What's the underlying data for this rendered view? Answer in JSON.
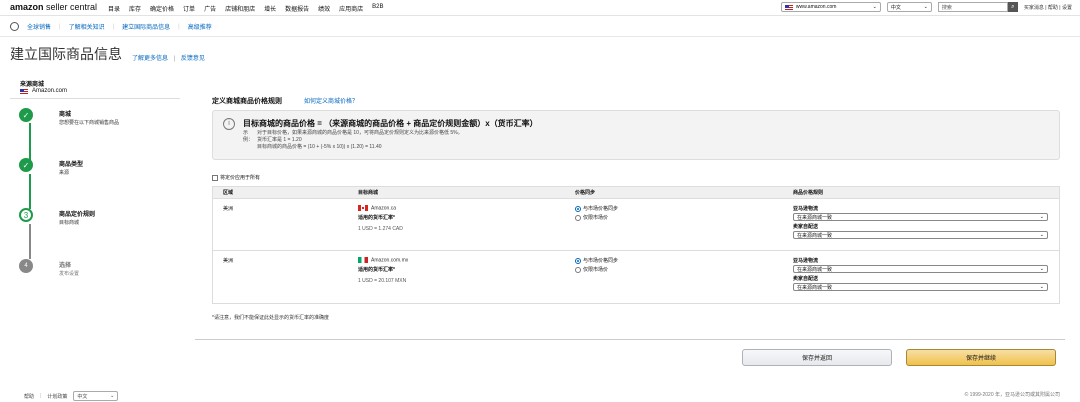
{
  "topnav": {
    "logo_brand": "amazon",
    "logo_product": "seller central",
    "menu": [
      "目录",
      "库存",
      "确定价格",
      "订单",
      "广告",
      "店铺和朋店",
      "增长",
      "数据报告",
      "绩效",
      "应用商店",
      "B2B"
    ],
    "marketplace": "www.amazon.com",
    "language": "中文",
    "search_placeholder": "搜索",
    "links": "买家消息 | 帮助 | 设置"
  },
  "subnav": {
    "items": [
      "全球销售",
      "了解相关知识",
      "建立国际商品信息",
      "高级推荐"
    ]
  },
  "page": {
    "title": "建立国际商品信息",
    "link1": "了解更多信息",
    "link2": "反馈意见"
  },
  "sidebar": {
    "source_label": "来源商城",
    "source_market": "Amazon.com",
    "steps": [
      {
        "label": "商城",
        "desc": "您想要在以下商城销售商品",
        "state": "done"
      },
      {
        "label": "商品类型",
        "desc": "来源",
        "state": "done"
      },
      {
        "label": "商品定价规则",
        "desc": "目标商城",
        "state": "current",
        "num": "3"
      },
      {
        "label": "选择",
        "desc": "发布设置",
        "state": "pending",
        "num": "4"
      }
    ]
  },
  "main": {
    "section_title": "定义商城商品价格规则",
    "section_link": "如何定义商城价格？",
    "info": {
      "formula": "目标商城的商品价格 = （来源商城的商品价格 + 商品定价规则金额）x（货币汇率）",
      "example_label": "示例：",
      "lines": [
        "对于目标价格，如果来源商城的商品价格是 10，可将商品定价规则定义为比来源价格低 5%。",
        "货币汇率是 1 = 1.20",
        "目标商城的商品价格 = (10 + (-5% x 10)) x (1.20) = 11.40"
      ]
    },
    "checkbox_label": "将定价应用于所有",
    "table": {
      "headers": [
        "区域",
        "目标商城",
        "价格同步",
        "商品价格规则"
      ],
      "rows": [
        {
          "region": "美洲",
          "market": "Amazon.ca",
          "currency_label": "适用的货币汇率*",
          "rate": "1 USD = 1.274 CAD",
          "radio1": "与市场价格同步",
          "radio2": "仅限市场价",
          "rule1_label": "亚马逊物流",
          "rule1_value": "在来源商城一致",
          "rule2_label": "卖家自配送",
          "rule2_value": "在来源商城一致"
        },
        {
          "region": "美洲",
          "market": "Amazon.com.mx",
          "currency_label": "适用的货币汇率*",
          "rate": "1 USD = 20.107 MXN",
          "radio1": "与市场价格同步",
          "radio2": "仅限市场价",
          "rule1_label": "亚马逊物流",
          "rule1_value": "在来源商城一致",
          "rule2_label": "卖家自配送",
          "rule2_value": "在来源商城一致"
        }
      ]
    },
    "note": "*请注意，我们不能保证此处显示的货币汇率的准确度",
    "back_button": "保存并返回",
    "save_button": "保存并继续"
  },
  "footer": {
    "help": "帮助",
    "policy": "计划政策",
    "language": "中文",
    "copyright": "© 1999-2020 年，亚马逊公司或其附属公司"
  }
}
